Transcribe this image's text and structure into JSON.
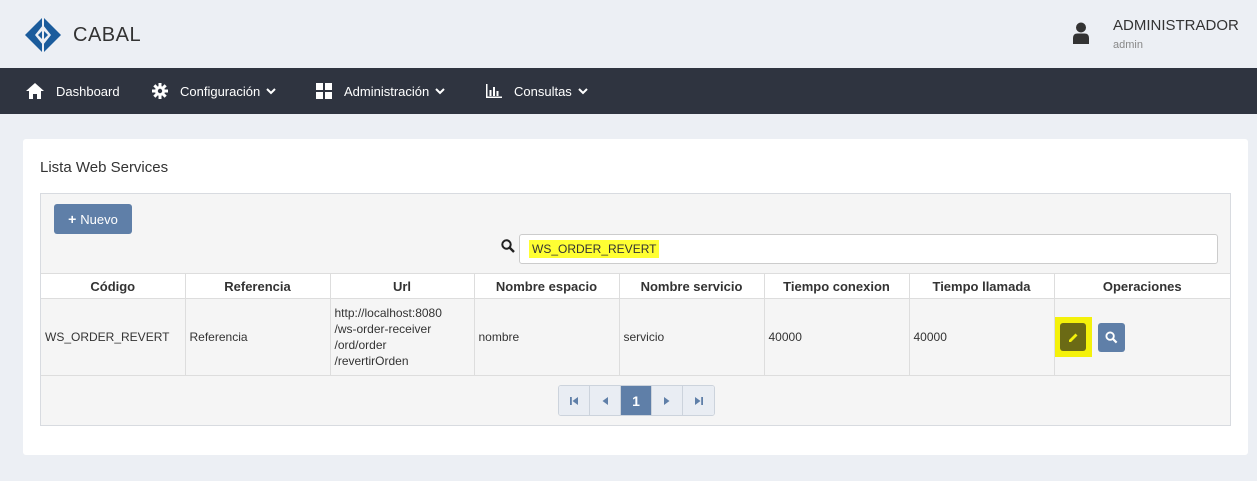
{
  "header": {
    "brand": "CABAL",
    "user_name": "ADMINISTRADOR",
    "user_sub": "admin"
  },
  "nav": {
    "items": [
      {
        "label": "Dashboard",
        "icon": "home-icon"
      },
      {
        "label": "Configuración",
        "icon": "gear-icon"
      },
      {
        "label": "Administración",
        "icon": "grid-icon"
      },
      {
        "label": "Consultas",
        "icon": "chart-icon"
      }
    ]
  },
  "panel": {
    "title": "Lista Web Services",
    "new_button": "Nuevo",
    "search_value": "WS_ORDER_REVERT"
  },
  "table": {
    "columns": [
      "Código",
      "Referencia",
      "Url",
      "Nombre espacio",
      "Nombre servicio",
      "Tiempo conexion",
      "Tiempo llamada",
      "Operaciones"
    ],
    "rows": [
      {
        "codigo": "WS_ORDER_REVERT",
        "referencia": "Referencia",
        "url_lines": [
          "http://localhost:8080",
          "/ws-order-receiver",
          "/ord/order",
          "/revertirOrden"
        ],
        "nombre_espacio": "nombre",
        "nombre_servicio": "servicio",
        "tiempo_conexion": "40000",
        "tiempo_llamada": "40000"
      }
    ]
  },
  "pagination": {
    "current_page": "1"
  },
  "colors": {
    "navbar": "#2f3440",
    "primary": "#5f7fa8",
    "highlight": "#ffff33"
  }
}
